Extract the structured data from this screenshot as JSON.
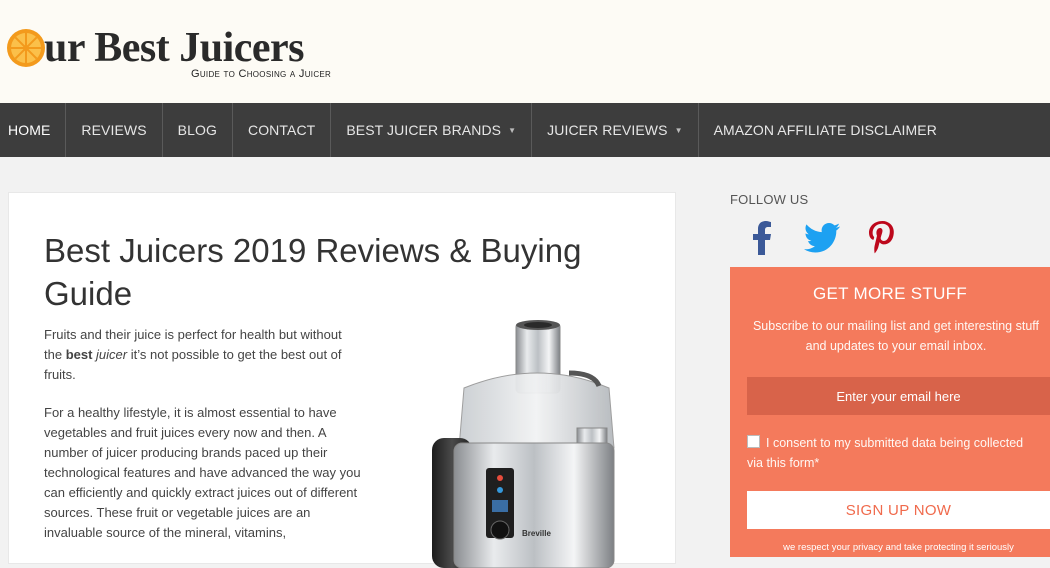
{
  "header": {
    "logo_text": "ur Best Juicers",
    "tagline": "Guide to Choosing a Juicer",
    "orange_color": "#f39a1c"
  },
  "nav": {
    "items": [
      {
        "label": "HOME"
      },
      {
        "label": "REVIEWS"
      },
      {
        "label": "BLOG"
      },
      {
        "label": "CONTACT"
      },
      {
        "label": "BEST JUICER BRANDS",
        "has_dropdown": true
      },
      {
        "label": "JUICER REVIEWS",
        "has_dropdown": true
      },
      {
        "label": "AMAZON AFFILIATE DISCLAIMER"
      }
    ]
  },
  "article": {
    "title": "Best Juicers 2019 Reviews & Buying Guide",
    "p1_before": "Fruits and their juice is perfect for health but without the ",
    "p1_bold": "best",
    "p1_italic": "juicer",
    "p1_after": " it’s not possible to get the best out of fruits.",
    "p2": "For a healthy lifestyle, it is almost essential to have vegetables and fruit juices every now and then. A number of juicer producing brands paced up their technological features and have advanced the way you can efficiently and quickly extract juices out of different sources. These fruit or vegetable juices are an invaluable source of the mineral, vitamins,",
    "product_brand": "Breville"
  },
  "sidebar": {
    "follow_label": "FOLLOW US",
    "social": [
      {
        "icon": "facebook-icon",
        "color": "#3b5998"
      },
      {
        "icon": "twitter-icon",
        "color": "#1da1f2"
      },
      {
        "icon": "pinterest-icon",
        "color": "#bd081c"
      }
    ],
    "optin": {
      "title": "GET MORE STUFF",
      "description": "Subscribe to our mailing list and get interesting stuff and updates to your email inbox.",
      "email_placeholder": "Enter your email here",
      "consent": "I consent to my submitted data being collected via this form*",
      "button": "SIGN UP NOW",
      "privacy": "we respect your privacy and take protecting it seriously",
      "bg_color": "#f47a5c"
    }
  }
}
